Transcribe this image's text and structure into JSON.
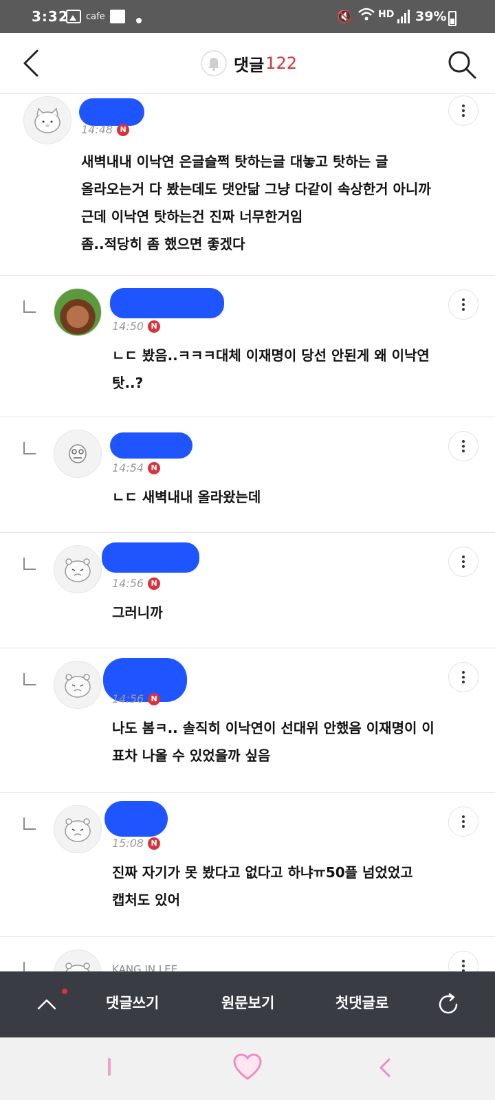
{
  "status_bar": {
    "time": "3:32",
    "cafe_label": "cafe",
    "hd_label": "HD",
    "battery": "39%",
    "icons": [
      "gallery-icon",
      "news-icon",
      "mute-icon",
      "wifi-icon",
      "signal-icon",
      "battery-icon"
    ]
  },
  "header": {
    "title": "댓글",
    "count": "122",
    "icons": [
      "back-icon",
      "bell-icon",
      "search-icon"
    ]
  },
  "comments": [
    {
      "reply": false,
      "avatar": "white-cat-avatar",
      "time": "14:48",
      "badge": "N",
      "body": "새벽내내 이낙연 은글슬쩍 탓하는글 대놓고 탓하는 글\n올라오는거 다 봤는데도 댓안닮 그냥 다같이 속상한거 아니까\n근데 이낙연 탓하는건 진짜 너무한거임\n좀..적당히 좀 했으면 좋겠다"
    },
    {
      "reply": true,
      "avatar": "photo-avatar",
      "time": "14:50",
      "badge": "N",
      "body": "ㄴㄷ 봤음..ㅋㅋㅋ대체 이재명이 당선 안된게 왜 이낙연\n탓..?"
    },
    {
      "reply": true,
      "avatar": "character-avatar",
      "time": "14:54",
      "badge": "N",
      "body": "ㄴㄷ 새벽내내 올라왔는데"
    },
    {
      "reply": true,
      "avatar": "hamster-avatar",
      "time": "14:56",
      "badge": "N",
      "body": "그러니까"
    },
    {
      "reply": true,
      "avatar": "hamster-avatar",
      "time": "14:56",
      "badge": "N",
      "body": "나도 봄ㅋ.. 솔직히 이낙연이 선대위 안했음 이재명이 이\n표차 나올 수 있었을까 싶음"
    },
    {
      "reply": true,
      "avatar": "hamster-avatar",
      "time": "15:08",
      "badge": "N",
      "body": "진짜 자기가 못 봤다고 없다고 하냐ㅠ50플 넘었었고\n캡처도 있어"
    },
    {
      "reply": true,
      "avatar": "hamster-avatar",
      "name": "KANG IN LEE",
      "time": "",
      "badge": "",
      "body": ""
    }
  ],
  "toolbar": {
    "write_label": "댓글쓰기",
    "view_original_label": "원문보기",
    "first_comment_label": "첫댓글로",
    "icons": [
      "up-arrow-icon",
      "refresh-icon"
    ]
  },
  "system_nav": {
    "icons": [
      "recent-apps-icon",
      "home-heart-icon",
      "back-nav-icon"
    ]
  },
  "colors": {
    "accent_red": "#d7333b",
    "toolbar_bg": "#3a3c44",
    "status_bar_bg": "#5a5a5a",
    "redaction_blue": "#1f55ff"
  }
}
